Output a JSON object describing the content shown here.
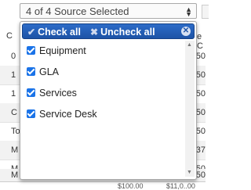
{
  "select": {
    "value": "4 of 4 Source Selected",
    "arrow_icon": "up-down-arrow-icon"
  },
  "dropdown": {
    "check_all": "Check all",
    "uncheck_all": "Uncheck all",
    "items": [
      {
        "label": "Equipment",
        "checked": true
      },
      {
        "label": "GLA",
        "checked": true
      },
      {
        "label": "Services",
        "checked": true
      },
      {
        "label": "Service Desk",
        "checked": true
      }
    ]
  },
  "background": {
    "header_left": "C",
    "header_right": "e C",
    "rows": [
      {
        "left": "0",
        "right": "50"
      },
      {
        "left": "1",
        "right": "50"
      },
      {
        "left": "1",
        "right": "50"
      },
      {
        "left": "C",
        "right": "50"
      },
      {
        "left": "To",
        "right": "50"
      },
      {
        "left": "M",
        "right": "37"
      },
      {
        "left": "M",
        "right": "50"
      },
      {
        "left": "M",
        "right": "50"
      }
    ],
    "footer_a": "$100.00",
    "footer_b": "$11,0..00"
  }
}
